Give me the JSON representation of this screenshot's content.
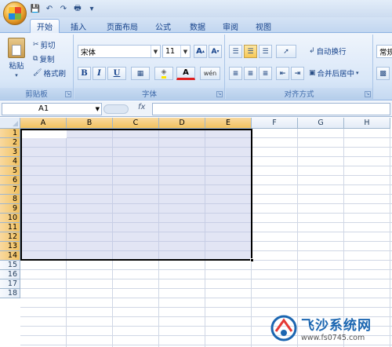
{
  "quick_access": {
    "icons": [
      "save-icon",
      "undo-icon",
      "redo-icon",
      "print-preview-icon",
      "customize-icon"
    ]
  },
  "tabs": [
    {
      "label": "开始",
      "active": true
    },
    {
      "label": "插入",
      "active": false
    },
    {
      "label": "页面布局",
      "active": false
    },
    {
      "label": "公式",
      "active": false
    },
    {
      "label": "数据",
      "active": false
    },
    {
      "label": "审阅",
      "active": false
    },
    {
      "label": "视图",
      "active": false
    }
  ],
  "ribbon": {
    "clipboard": {
      "paste": "粘贴",
      "cut": "剪切",
      "copy": "复制",
      "format_painter": "格式刷",
      "label": "剪贴板"
    },
    "font": {
      "name": "宋体",
      "size": "11",
      "grow": "A",
      "shrink": "A",
      "bold": "B",
      "italic": "I",
      "underline": "U",
      "font_color": "A",
      "phonetic": "wén",
      "label": "字体"
    },
    "alignment": {
      "wrap_text": "自动换行",
      "merge_center": "合并后居中",
      "label": "对齐方式"
    },
    "number": {
      "format": "常规"
    }
  },
  "formula_bar": {
    "name_box": "A1",
    "fx": "fx",
    "formula": ""
  },
  "sheet": {
    "columns": [
      "A",
      "B",
      "C",
      "D",
      "E",
      "F",
      "G",
      "H"
    ],
    "rows": [
      "1",
      "2",
      "3",
      "4",
      "5",
      "6",
      "7",
      "8",
      "9",
      "10",
      "11",
      "12",
      "13",
      "14",
      "15",
      "16",
      "17",
      "18"
    ],
    "selected_columns": [
      "A",
      "B",
      "C",
      "D",
      "E"
    ],
    "selected_rows": [
      "1",
      "2",
      "3",
      "4",
      "5",
      "6",
      "7",
      "8",
      "9",
      "10",
      "11",
      "12",
      "13",
      "14"
    ],
    "selection_range": "A1:E14",
    "colors": {
      "selection_fill": "#bac2e4",
      "header_highlight": "#f1c15f",
      "gridline": "#d0d7e5"
    }
  },
  "watermark": {
    "brand": "飞沙系统网",
    "url": "www.fs0745.com"
  }
}
